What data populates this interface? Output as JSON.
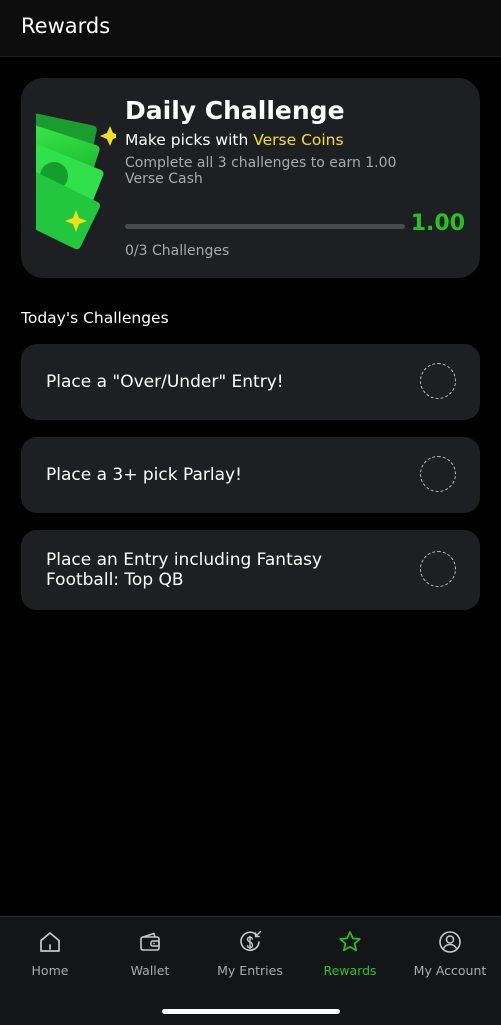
{
  "header": {
    "title": "Rewards"
  },
  "daily_challenge": {
    "title": "Daily Challenge",
    "subtitle_prefix": "Make picks with ",
    "subtitle_accent": "Verse Coins",
    "description": "Complete all 3 challenges to earn 1.00 Verse Cash",
    "reward_amount": "1.00",
    "progress_text": "0/3 Challenges",
    "progress_fraction": 0.0,
    "accent_color": "#f3e01a",
    "success_color": "#23c41e"
  },
  "challenges_section": {
    "title": "Today's Challenges",
    "items": [
      {
        "label": "Place a \"Over/Under\" Entry!",
        "completed": false
      },
      {
        "label": "Place a 3+ pick Parlay!",
        "completed": false
      },
      {
        "label": "Place an Entry including Fantasy Football: Top QB",
        "completed": false
      }
    ]
  },
  "bottom_nav": {
    "items": [
      {
        "label": "Home",
        "icon": "home-icon",
        "active": false
      },
      {
        "label": "Wallet",
        "icon": "wallet-icon",
        "active": false
      },
      {
        "label": "My Entries",
        "icon": "dollar-entries-icon",
        "active": false
      },
      {
        "label": "Rewards",
        "icon": "star-icon",
        "active": true
      },
      {
        "label": "My Account",
        "icon": "account-icon",
        "active": false
      }
    ]
  }
}
